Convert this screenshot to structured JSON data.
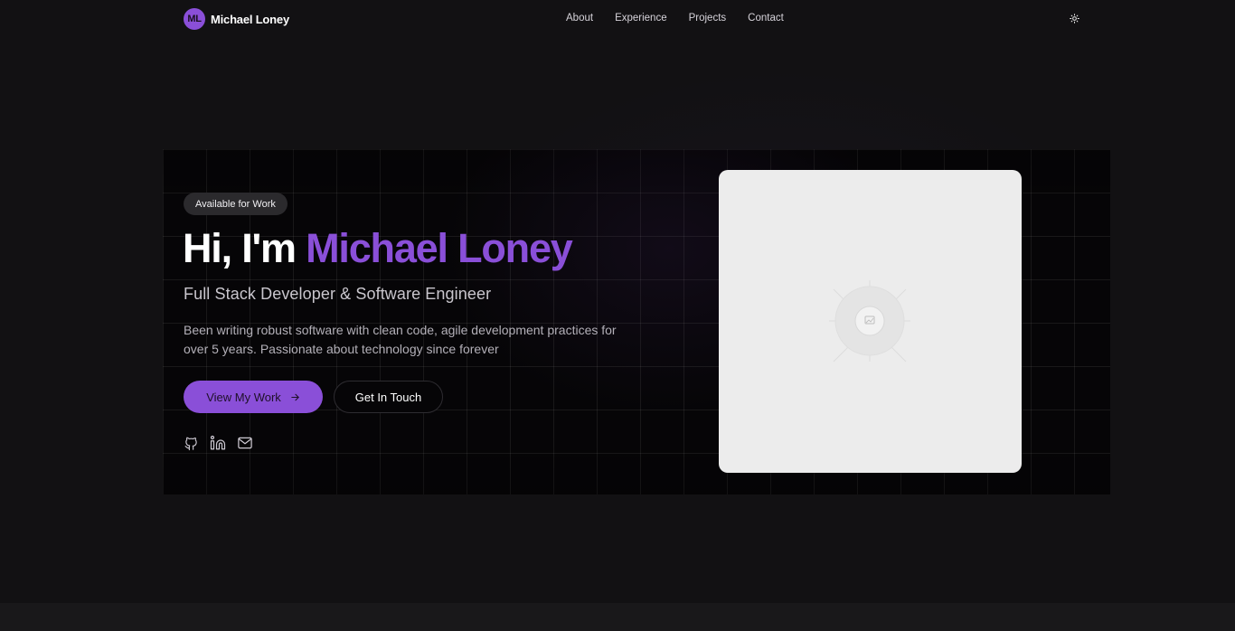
{
  "nav": {
    "logo_initials": "ML",
    "logo_name": "Michael Loney",
    "links": [
      "About",
      "Experience",
      "Projects",
      "Contact"
    ],
    "theme_icon": "sun-icon"
  },
  "hero": {
    "badge": "Available for Work",
    "greeting": "Hi, I'm ",
    "name": "Michael Loney",
    "subtitle": "Full Stack Developer & Software Engineer",
    "description": "Been writing robust software with clean code, agile development practices for over 5 years. Passionate about technology since forever",
    "primary_button": "View My Work",
    "primary_button_icon": "arrow-right-icon",
    "secondary_button": "Get In Touch",
    "socials": [
      "github-icon",
      "linkedin-icon",
      "mail-icon"
    ],
    "image_placeholder_icon": "image-placeholder-icon"
  },
  "colors": {
    "accent": "#8a4fd8",
    "background": "#121113",
    "hero_background": "#060507",
    "card": "#ececec"
  }
}
